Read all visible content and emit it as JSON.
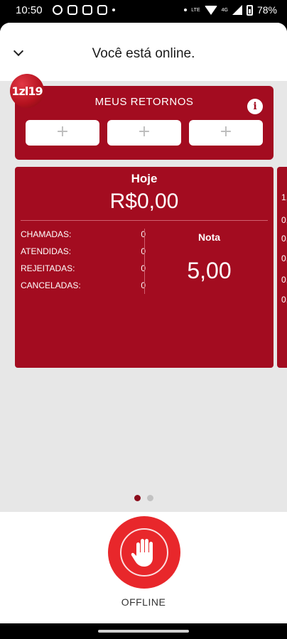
{
  "status_bar": {
    "time": "10:50",
    "battery": "78%",
    "network": "4G",
    "lte": "LTE"
  },
  "header": {
    "title": "Você está online."
  },
  "logo": {
    "text": "1zl19"
  },
  "retornos": {
    "title": "MEUS RETORNOS",
    "info_glyph": "i",
    "slots": [
      "+",
      "+",
      "+"
    ]
  },
  "summary": {
    "period": "Hoje",
    "amount": "R$0,00",
    "stats": [
      {
        "label": "CHAMADAS:",
        "value": "0"
      },
      {
        "label": "ATENDIDAS:",
        "value": "0"
      },
      {
        "label": "REJEITADAS:",
        "value": "0"
      },
      {
        "label": "CANCELADAS:",
        "value": "0"
      }
    ],
    "rating_label": "Nota",
    "rating_value": "5,00"
  },
  "next_card_peek": [
    "1,",
    "0,",
    "0,",
    "0,",
    "0,",
    "0,"
  ],
  "pager": {
    "count": 2,
    "active": 0
  },
  "offline": {
    "label": "OFFLINE"
  },
  "colors": {
    "brand_red": "#a30c20",
    "button_red": "#e8272b",
    "background": "#e7e7e7"
  }
}
